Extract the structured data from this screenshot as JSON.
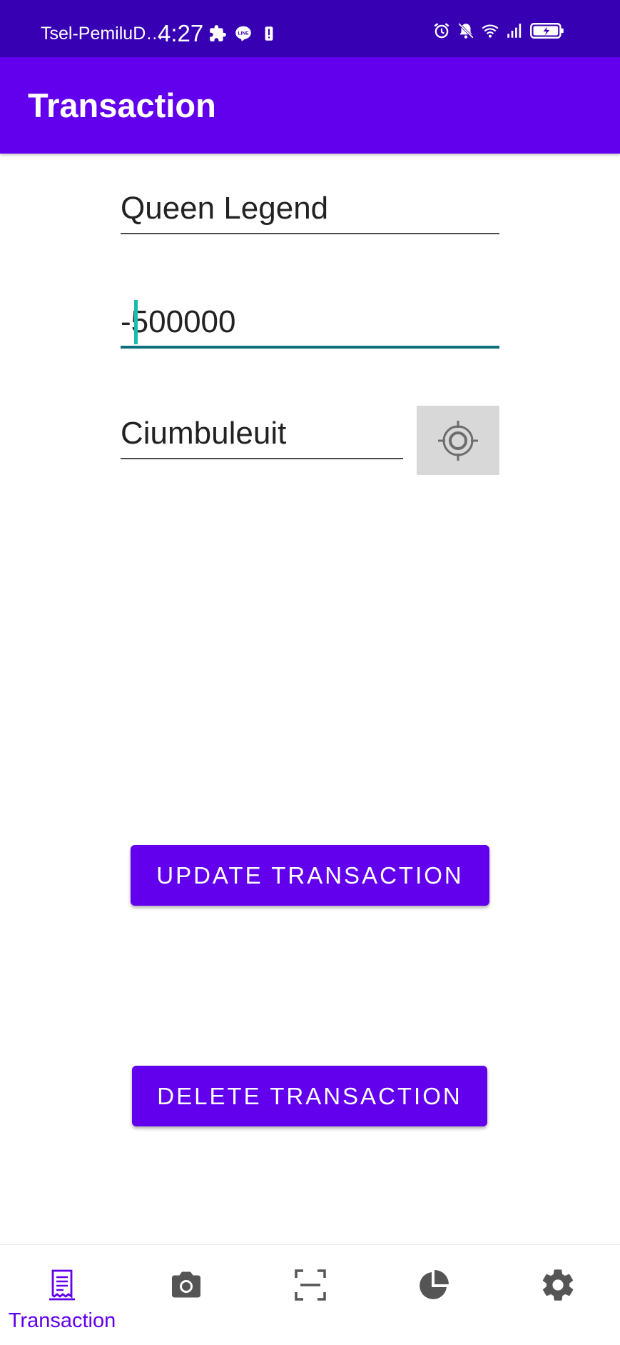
{
  "status_bar": {
    "carrier": "Tsel-PemiluD…",
    "time": "4:27",
    "notification_icons": [
      "puzzle-icon",
      "line-app-icon",
      "alert-icon"
    ],
    "system_icons": [
      "alarm-icon",
      "bell-off-icon",
      "wifi-icon",
      "signal-icon",
      "battery-charging-icon"
    ]
  },
  "app_bar": {
    "title": "Transaction"
  },
  "form": {
    "name_value": "Queen Legend",
    "amount_value": "-500000",
    "location_value": "Ciumbuleuit",
    "locate_icon": "crosshair-icon"
  },
  "buttons": {
    "update_label": "UPDATE TRANSACTION",
    "delete_label": "DELETE TRANSACTION"
  },
  "bottom_nav": {
    "items": [
      {
        "icon": "receipt-icon",
        "label": "Transaction",
        "active": true
      },
      {
        "icon": "camera-icon",
        "label": "",
        "active": false
      },
      {
        "icon": "scan-icon",
        "label": "",
        "active": false
      },
      {
        "icon": "pie-chart-icon",
        "label": "",
        "active": false
      },
      {
        "icon": "gear-icon",
        "label": "",
        "active": false
      }
    ]
  },
  "colors": {
    "status_bar": "#3700b3",
    "primary": "#6200ee",
    "focus_underline": "#0e6f7a",
    "cursor": "#18bdb0",
    "nav_inactive": "#555555"
  }
}
